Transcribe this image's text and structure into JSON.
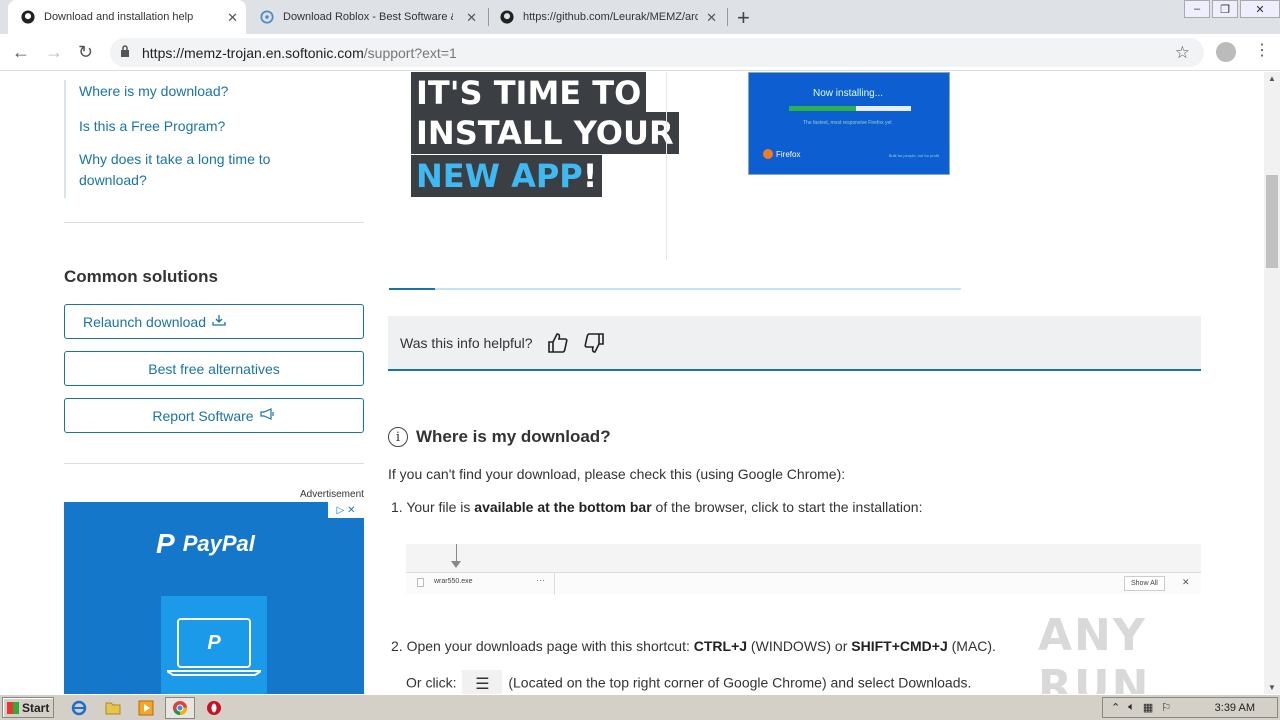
{
  "browser": {
    "tabs": [
      {
        "title": "Download and installation help",
        "close": "✕"
      },
      {
        "title": "Download Roblox - Best Software & Apps",
        "close": "✕"
      },
      {
        "title": "https://github.com/Leurak/MEMZ/archive",
        "close": "✕"
      }
    ],
    "new_tab": "+",
    "url_host": "https://memz-trojan.en.softonic.com",
    "url_path": "/support?ext=1"
  },
  "sidebar": {
    "links": [
      {
        "label": "Where is my download?"
      },
      {
        "label": "Is this a Free Program?"
      },
      {
        "label_line1": "Why does it take a long time to",
        "label_line2": "download?"
      }
    ],
    "common_title": "Common solutions",
    "buttons": [
      {
        "label": "Relaunch download"
      },
      {
        "label": "Best free alternatives"
      },
      {
        "label": "Report Software"
      }
    ],
    "ad_label": "Advertisement",
    "ad_brand": "PayPal"
  },
  "banner": {
    "line1": "IT'S TIME TO",
    "line2": "INSTALL YOUR",
    "line3_highlight": "NEW APP",
    "line3_end": "!",
    "install_now": "Now installing...",
    "install_progress": 0.55,
    "install_sub": "The fastest, most responsive Firefox yet",
    "install_brand": "Firefox",
    "install_tag": "Built for people, not for profit",
    "video_progress": 0.08
  },
  "helpful": {
    "question": "Was this info helpful?"
  },
  "section": {
    "title": "Where is my download?",
    "intro": "If you can't find your download, please check this (using Google Chrome):",
    "step1_num": "1.",
    "step1_pre": "Your file is ",
    "step1_bold": "available at the bottom bar",
    "step1_post": " of the browser, click to start the installation:",
    "dl_file": "wrar550.exe",
    "dl_show_all": "Show All",
    "step2_num": "2.",
    "step2_pre": "Open your downloads page with this shortcut: ",
    "step2_bold1": "CTRL+J",
    "step2_mid": " (WINDOWS) or ",
    "step2_bold2": "SHIFT+CMD+J",
    "step2_post": " (MAC).",
    "step2b_pre": "Or click: ",
    "step2b_post": " (Located on the top right corner of Google Chrome) and select Downloads."
  },
  "watermark": "ANY RUN",
  "taskbar": {
    "start": "Start",
    "clock": "3:39 AM"
  },
  "colors": {
    "accent": "#1a73a8",
    "ad_bg": "#1577c9",
    "banner_highlight": "#3fb9f2"
  }
}
